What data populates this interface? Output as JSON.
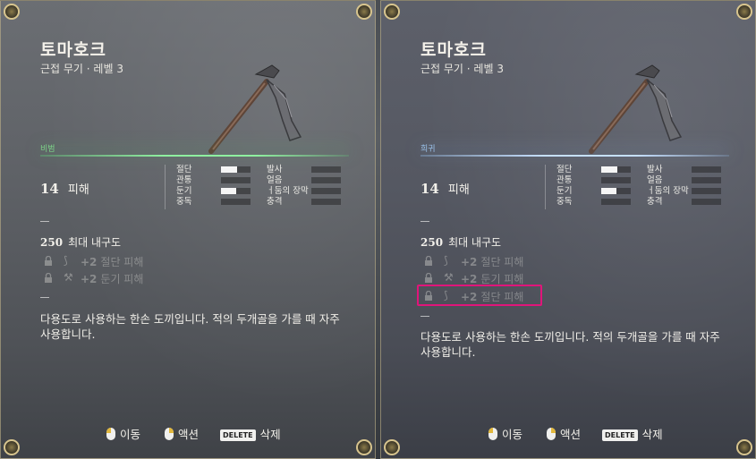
{
  "left_card": {
    "title": "토마호크",
    "subtitle": "근접 무기 · 레벨 3",
    "rarity": "비범",
    "damage_value": "14",
    "damage_label": "피해",
    "stats_left": [
      {
        "label": "절단",
        "level": 0.55
      },
      {
        "label": "관통",
        "level": 0
      },
      {
        "label": "둔기",
        "level": 0.5
      },
      {
        "label": "중독",
        "level": 0
      }
    ],
    "stats_right": [
      {
        "label": "발사",
        "level": 0
      },
      {
        "label": "얼음",
        "level": 0
      },
      {
        "label": "ㅓ둠의 장막",
        "level": 0
      },
      {
        "label": "충격",
        "level": 0
      }
    ],
    "durability_value": "250",
    "durability_label": "최대 내구도",
    "upgrades": [
      {
        "plus": "+2",
        "text": "절단 피해",
        "icon": "slash-icon"
      },
      {
        "plus": "+2",
        "text": "둔기 피해",
        "icon": "hammer-icon"
      }
    ],
    "description": "다용도로 사용하는 한손 도끼입니다. 적의 두개골을 가를 때 자주 사용합니다."
  },
  "right_card": {
    "title": "토마호크",
    "subtitle": "근접 무기 · 레벨 3",
    "rarity": "희귀",
    "damage_value": "14",
    "damage_label": "피해",
    "stats_left": [
      {
        "label": "절단",
        "level": 0.55
      },
      {
        "label": "관통",
        "level": 0
      },
      {
        "label": "둔기",
        "level": 0.5
      },
      {
        "label": "중독",
        "level": 0
      }
    ],
    "stats_right": [
      {
        "label": "발사",
        "level": 0
      },
      {
        "label": "얼음",
        "level": 0
      },
      {
        "label": "ㅓ둠의 장막",
        "level": 0
      },
      {
        "label": "충격",
        "level": 0
      }
    ],
    "durability_value": "250",
    "durability_label": "최대 내구도",
    "upgrades": [
      {
        "plus": "+2",
        "text": "절단 피해",
        "icon": "slash-icon"
      },
      {
        "plus": "+2",
        "text": "둔기 피해",
        "icon": "hammer-icon"
      },
      {
        "plus": "+2",
        "text": "절단 피해",
        "icon": "slash-icon"
      }
    ],
    "description": "다용도로 사용하는 한손 도끼입니다. 적의 두개골을 가를 때 자주 사용합니다."
  },
  "footer": {
    "move_label": "이동",
    "action_label": "액션",
    "delete_key": "DELETE",
    "delete_label": "삭제"
  },
  "colors": {
    "uncommon": "#7fd38a",
    "rare": "#9cc3ea",
    "highlight": "#e0157a",
    "frame": "#d8c58e"
  }
}
